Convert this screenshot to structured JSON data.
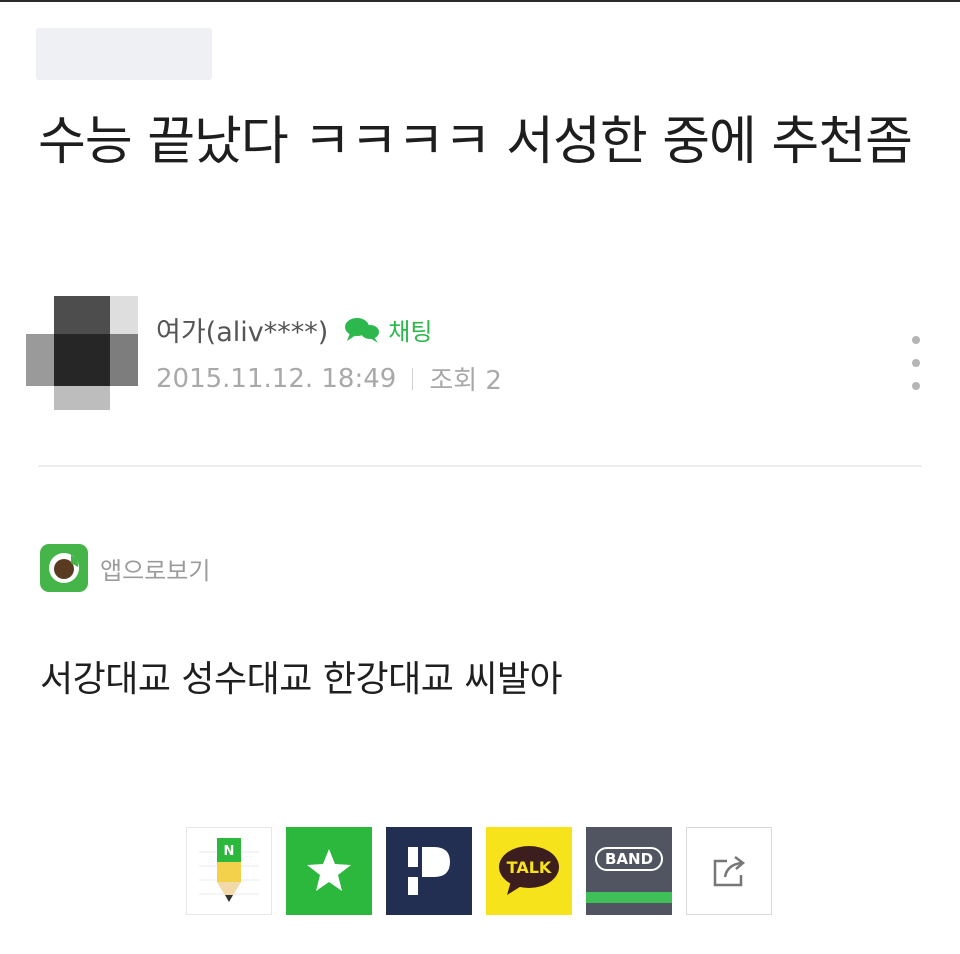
{
  "post": {
    "title": "수능 끝났다 ㅋㅋㅋㅋ 서성한 중에 추천좀",
    "body": "서강대교 성수대교 한강대교 씨발아"
  },
  "author": {
    "name": "여가(aliv****)",
    "chat_label": "채팅",
    "date": "2015.11.12. 18:49",
    "views": "조회 2"
  },
  "app_view": {
    "label": "앱으로보기"
  },
  "share": {
    "kakao_label": "TALK",
    "band_label": "BAND",
    "blog_label": "N",
    "icons": [
      "blog-icon",
      "bookmark-star-icon",
      "pholar-icon",
      "kakaotalk-icon",
      "band-icon",
      "share-export-icon"
    ]
  },
  "colors": {
    "chat_green": "#2db84d",
    "bookmark_green": "#2cb83c",
    "kakao_yellow": "#f7e31b",
    "band_dark": "#515561",
    "pholar_navy": "#222e52"
  }
}
